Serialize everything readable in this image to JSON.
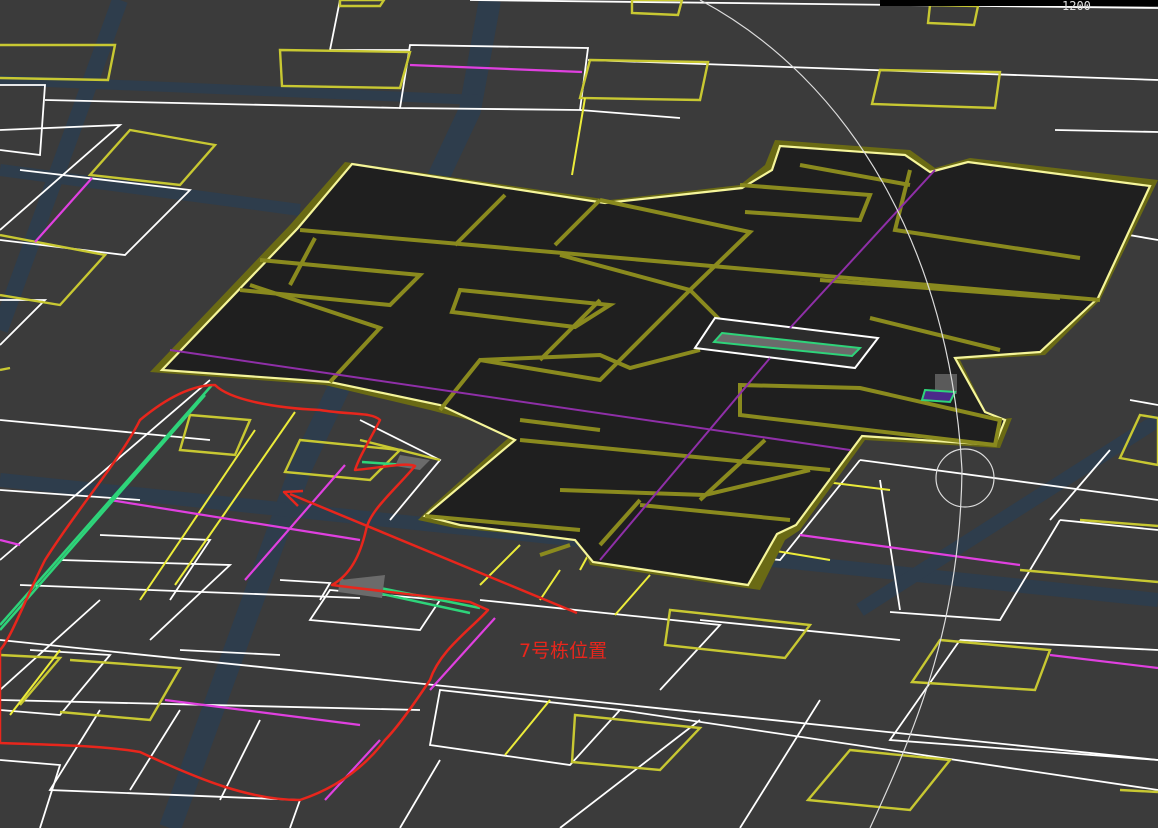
{
  "viewer": {
    "annotation_label": "7号栋位置",
    "ruler_text": "1200",
    "colors": {
      "background": "#3b3b3b",
      "road": "#2e3d4c",
      "building_fill": "#1f1f1f",
      "building_outline": "#f5f59a",
      "olive": "#8a8a1e",
      "parcel_line": "#ffffff",
      "yellow_line": "#c8c832",
      "magenta_line": "#e040e0",
      "green_line": "#2ed47a",
      "annotation": "#e8261c"
    }
  }
}
